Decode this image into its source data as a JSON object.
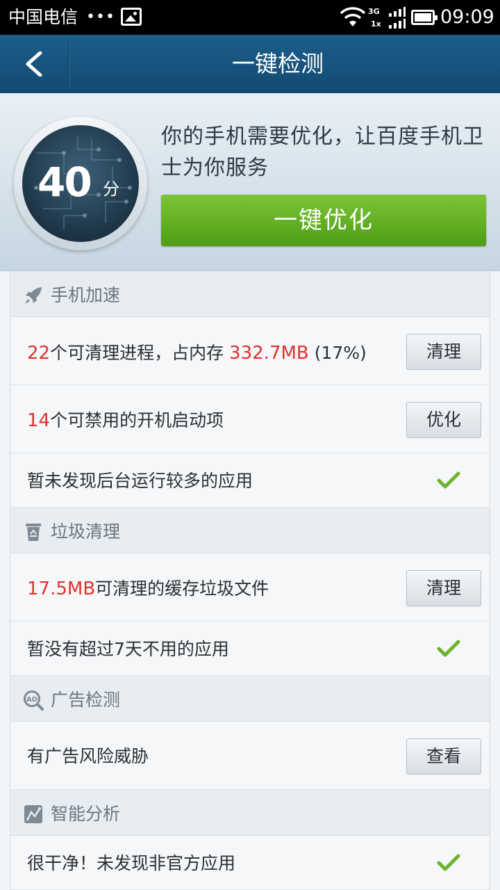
{
  "status_bar": {
    "carrier": "中国电信",
    "dots": "•••",
    "network_top": "3G",
    "network_bottom": "1x",
    "time": "09:09"
  },
  "header": {
    "title": "一键检测",
    "back_icon": "chevron-left-icon"
  },
  "score": {
    "value": "40",
    "unit": "分",
    "message": "你的手机需要优化，让百度手机卫士为你服务",
    "optimize_button": "一键优化"
  },
  "colors": {
    "header": "#1a5580",
    "optimize_button": "#62b024",
    "highlight": "#e0322e",
    "check": "#6bb32e"
  },
  "sections": [
    {
      "title": "手机加速",
      "icon": "rocket-icon",
      "items": [
        {
          "highlight": "22",
          "text": "个可清理进程，占内存 ",
          "highlight2": "332.7MB",
          "text2": " (17%)",
          "action": "清理"
        },
        {
          "highlight": "14",
          "text": "个可禁用的开机启动项",
          "action": "优化"
        },
        {
          "text": "暂未发现后台运行较多的应用",
          "status": "check-icon"
        }
      ]
    },
    {
      "title": "垃圾清理",
      "icon": "trash-recycle-icon",
      "items": [
        {
          "highlight": "17.5MB",
          "text": "可清理的缓存垃圾文件",
          "action": "清理"
        },
        {
          "text": "暂没有超过7天不用的应用",
          "status": "check-icon"
        }
      ]
    },
    {
      "title": "广告检测",
      "icon": "ad-search-icon",
      "items": [
        {
          "text": "有广告风险威胁",
          "action": "查看"
        }
      ]
    },
    {
      "title": "智能分析",
      "icon": "smart-analysis-icon",
      "items": [
        {
          "text": "很干净！未发现非官方应用",
          "status": "check-icon"
        }
      ]
    }
  ]
}
